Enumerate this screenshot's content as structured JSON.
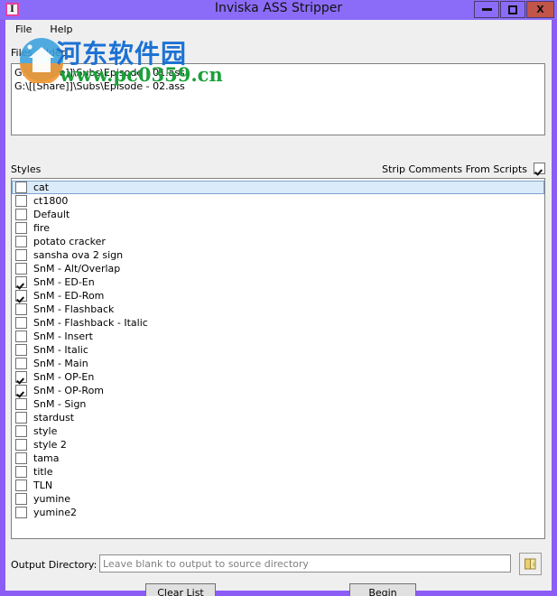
{
  "window": {
    "title": "Inviska ASS Stripper",
    "icon": "app-icon-i",
    "accent_color": "#8b6cf8",
    "close_color": "#c2554a",
    "controls": {
      "minimize": "minimize-icon",
      "maximize": "maximize-icon",
      "close": "X"
    }
  },
  "menubar": {
    "items": [
      {
        "label": "File"
      },
      {
        "label": "Help"
      }
    ]
  },
  "files": {
    "label": "Files Added",
    "items": [
      "G:\\[[Share]]\\Subs\\Episode - 01.ass",
      "G:\\[[Share]]\\Subs\\Episode - 02.ass"
    ]
  },
  "styles_section": {
    "label": "Styles",
    "strip_comments": {
      "label": "Strip Comments From Scripts",
      "checked": true
    },
    "items": [
      {
        "label": "cat",
        "checked": false,
        "selected": true
      },
      {
        "label": "ct1800",
        "checked": false,
        "selected": false
      },
      {
        "label": "Default",
        "checked": false,
        "selected": false
      },
      {
        "label": "fire",
        "checked": false,
        "selected": false
      },
      {
        "label": "potato cracker",
        "checked": false,
        "selected": false
      },
      {
        "label": "sansha ova 2 sign",
        "checked": false,
        "selected": false
      },
      {
        "label": "SnM - Alt/Overlap",
        "checked": false,
        "selected": false
      },
      {
        "label": "SnM - ED-En",
        "checked": true,
        "selected": false
      },
      {
        "label": "SnM - ED-Rom",
        "checked": true,
        "selected": false
      },
      {
        "label": "SnM - Flashback",
        "checked": false,
        "selected": false
      },
      {
        "label": "SnM - Flashback - Italic",
        "checked": false,
        "selected": false
      },
      {
        "label": "SnM - Insert",
        "checked": false,
        "selected": false
      },
      {
        "label": "SnM - Italic",
        "checked": false,
        "selected": false
      },
      {
        "label": "SnM - Main",
        "checked": false,
        "selected": false
      },
      {
        "label": "SnM - OP-En",
        "checked": true,
        "selected": false
      },
      {
        "label": "SnM - OP-Rom",
        "checked": true,
        "selected": false
      },
      {
        "label": "SnM - Sign",
        "checked": false,
        "selected": false
      },
      {
        "label": "stardust",
        "checked": false,
        "selected": false
      },
      {
        "label": "style",
        "checked": false,
        "selected": false
      },
      {
        "label": "style 2",
        "checked": false,
        "selected": false
      },
      {
        "label": "tama",
        "checked": false,
        "selected": false
      },
      {
        "label": "title",
        "checked": false,
        "selected": false
      },
      {
        "label": "TLN",
        "checked": false,
        "selected": false
      },
      {
        "label": "yumine",
        "checked": false,
        "selected": false
      },
      {
        "label": "yumine2",
        "checked": false,
        "selected": false
      }
    ]
  },
  "output": {
    "label": "Output Directory:",
    "value": "",
    "placeholder": "Leave blank to output to source directory",
    "browse_icon": "folder-icon"
  },
  "actions": {
    "clear_list": "Clear List",
    "begin": "Begin"
  },
  "watermark": {
    "chinese_text": "河东软件园",
    "url_text": "www.pc0359.cn",
    "chinese_color": "#1c72d4",
    "url_color": "#1aa03a"
  }
}
